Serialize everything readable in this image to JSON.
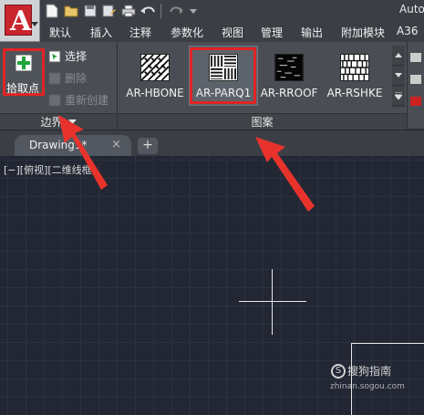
{
  "app": {
    "logo_letter": "A",
    "title": "Auto",
    "accent": "#c8252c"
  },
  "quick_access": [
    "new-icon",
    "open-icon",
    "save-icon",
    "save-as-icon",
    "print-icon",
    "undo-icon",
    "redo-icon"
  ],
  "tabs": [
    "默认",
    "插入",
    "注释",
    "参数化",
    "视图",
    "管理",
    "输出",
    "附加模块",
    "A36"
  ],
  "boundary_panel": {
    "pick_points_label": "拾取点",
    "select_label": "选择",
    "remove_label": "删除",
    "recreate_label": "重新创建",
    "title": "边界"
  },
  "pattern_panel": {
    "title": "图案",
    "items": [
      {
        "name": "AR-HBONE",
        "selected": false
      },
      {
        "name": "AR-PARQ1",
        "selected": true
      },
      {
        "name": "AR-RROOF",
        "selected": false
      },
      {
        "name": "AR-RSHKE",
        "selected": false
      }
    ]
  },
  "document": {
    "tab_name": "Drawing1*",
    "close": "×",
    "new_tab": "+"
  },
  "viewport": {
    "controls_label": "[−][俯视][二维线框]"
  },
  "watermark": {
    "glyph": "S",
    "text": "搜狗指南",
    "url": "zhinan.sogou.com"
  },
  "highlight_color": "#e02424"
}
